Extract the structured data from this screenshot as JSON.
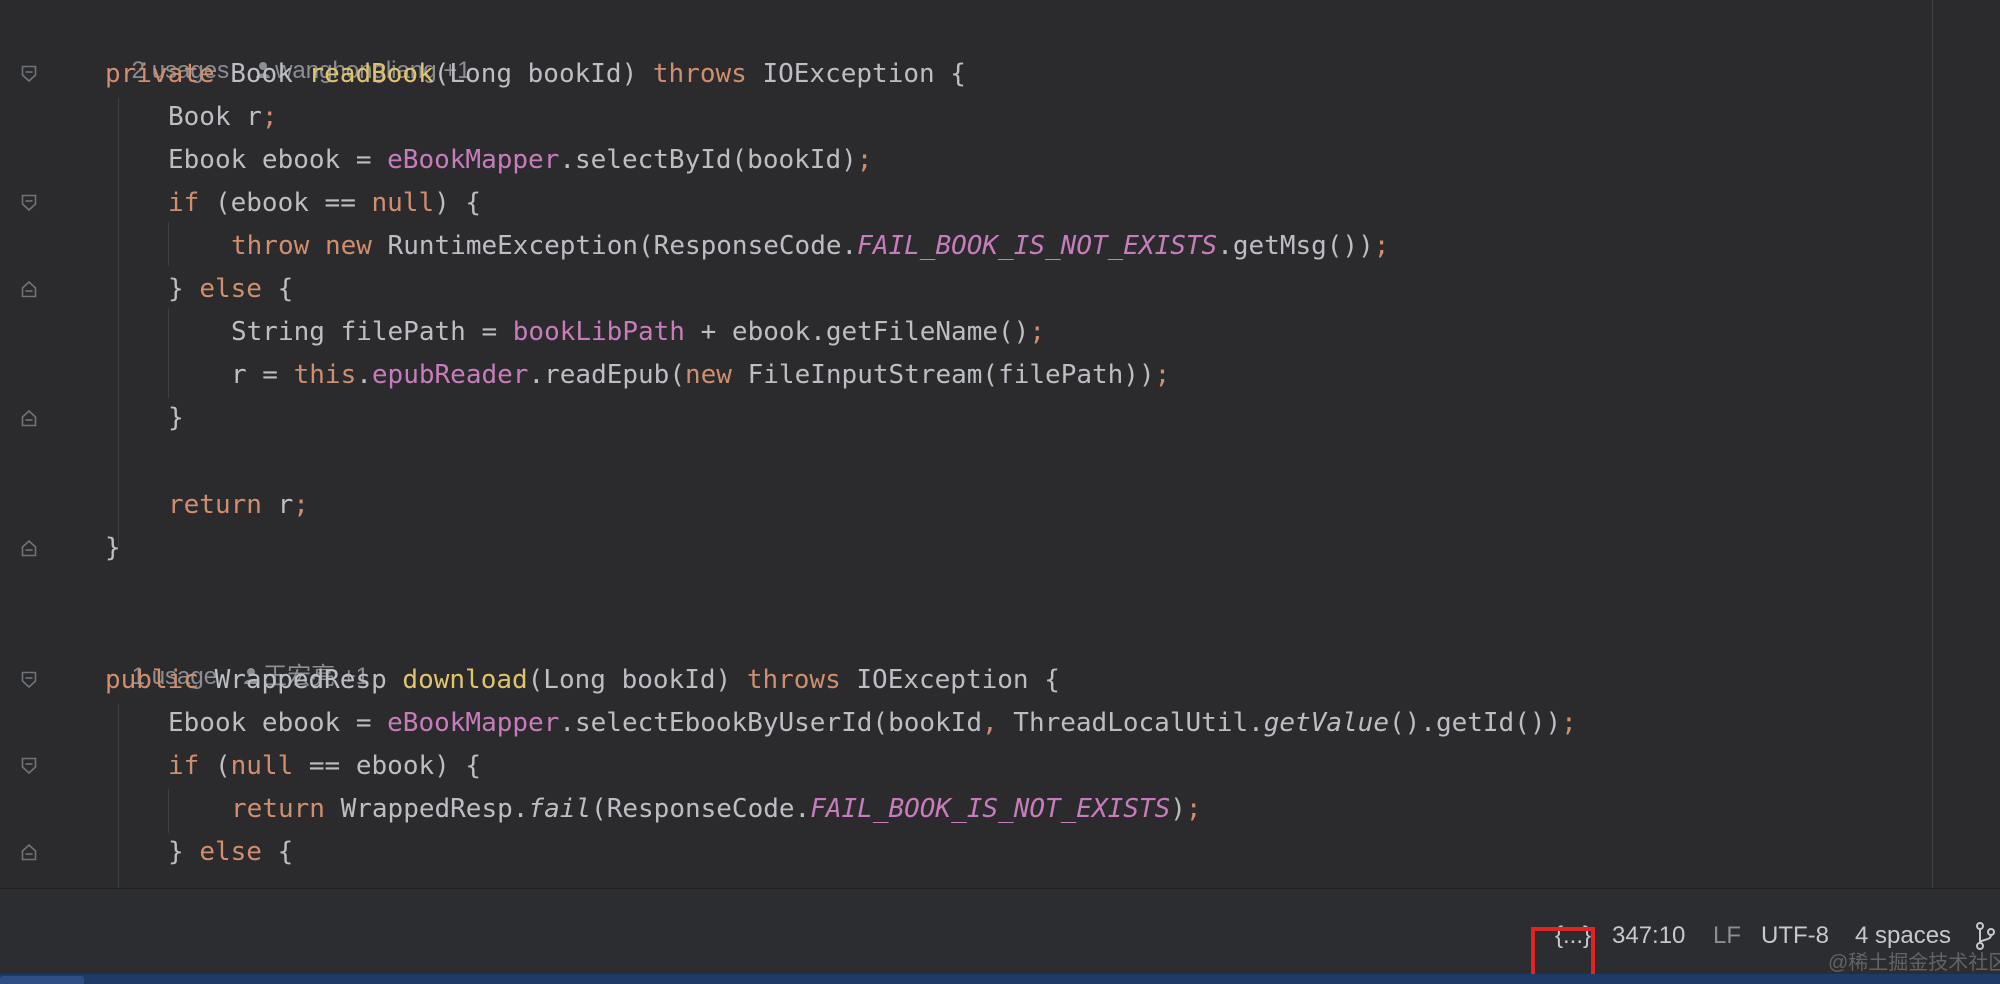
{
  "inlays": [
    {
      "usages": "2 usages",
      "author": "wanghongliang +1"
    },
    {
      "usages": "1 usage",
      "author": "王宏亮 +1"
    }
  ],
  "code": {
    "m1_sig": [
      "private",
      " Book ",
      "readBook",
      "(Long bookId) ",
      "throws",
      " IOException {"
    ],
    "m1_l1": [
      "Book r",
      ";"
    ],
    "m1_l2": [
      "Ebook ebook = ",
      "eBookMapper",
      ".selectById(bookId)",
      ";"
    ],
    "m1_l3": [
      "if",
      " (ebook == ",
      "null",
      ") {"
    ],
    "m1_l4": [
      "throw",
      " ",
      "new",
      " RuntimeException(ResponseCode.",
      "FAIL_BOOK_IS_NOT_EXISTS",
      ".getMsg())",
      ";"
    ],
    "m1_l5": [
      "} ",
      "else",
      " {"
    ],
    "m1_l6": [
      "String filePath = ",
      "bookLibPath",
      " + ebook.getFileName()",
      ";"
    ],
    "m1_l7": [
      "r = ",
      "this",
      ".",
      "epubReader",
      ".readEpub(",
      "new",
      " FileInputStream(filePath))",
      ";"
    ],
    "m1_l8": [
      "}"
    ],
    "m1_l9": [
      "return",
      " r",
      ";"
    ],
    "m1_l10": [
      "}"
    ],
    "m2_sig": [
      "public",
      " WrappedResp ",
      "download",
      "(Long bookId) ",
      "throws",
      " IOException {"
    ],
    "m2_l1": [
      "Ebook ebook = ",
      "eBookMapper",
      ".selectEbookByUserId(bookId",
      ",",
      " ThreadLocalUtil.",
      "getValue",
      "().getId())",
      ";"
    ],
    "m2_l2": [
      "if",
      " (",
      "null",
      " == ebook) {"
    ],
    "m2_l3": [
      "return",
      " WrappedResp.",
      "fail",
      "(ResponseCode.",
      "FAIL_BOOK_IS_NOT_EXISTS",
      ")",
      ";"
    ],
    "m2_l4": [
      "} ",
      "else",
      " {"
    ]
  },
  "status_bar": {
    "braces": "{...}",
    "position": "347:10",
    "line_sep": "LF",
    "encoding": "UTF-8",
    "indent": "4 spaces"
  },
  "watermark": "@稀土掘金技术社区",
  "colors": {
    "keyword": "#cf8e6d",
    "declaration": "#e0c46c",
    "field": "#c77dbb",
    "text": "#bcbec4",
    "highlight": "#e02424"
  }
}
